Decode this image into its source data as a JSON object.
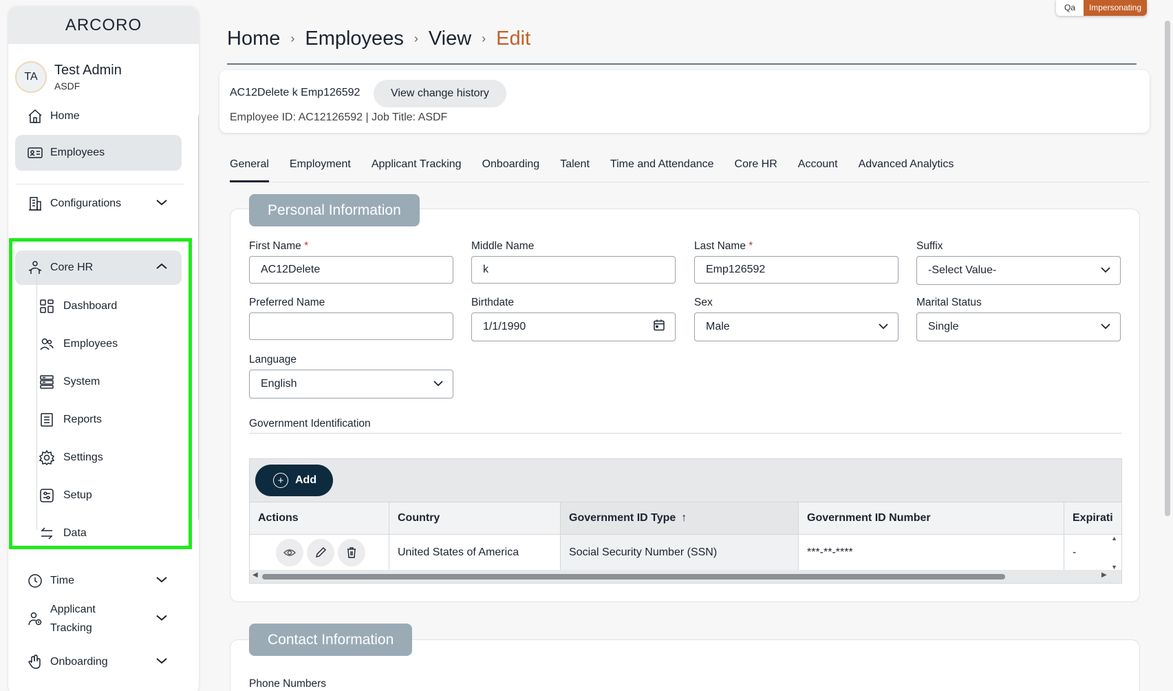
{
  "impersonation": {
    "env": "Qa",
    "label": "Impersonating"
  },
  "sidebar": {
    "logo": "ARCORO",
    "user": {
      "initials": "TA",
      "name": "Test Admin",
      "org": "ASDF"
    },
    "items": [
      {
        "label": "Home",
        "icon": "home-icon"
      },
      {
        "label": "Employees",
        "icon": "id-card-icon"
      },
      {
        "label": "Configurations",
        "icon": "building-icon"
      },
      {
        "label": "Core HR",
        "icon": "people-star-icon"
      }
    ],
    "core_hr_sub": [
      {
        "label": "Dashboard",
        "icon": "dashboard-icon"
      },
      {
        "label": "Employees",
        "icon": "users-icon"
      },
      {
        "label": "System",
        "icon": "server-icon"
      },
      {
        "label": "Reports",
        "icon": "report-icon"
      },
      {
        "label": "Settings",
        "icon": "gear-icon"
      },
      {
        "label": "Setup",
        "icon": "sliders-icon"
      },
      {
        "label": "Data",
        "icon": "transfer-icon"
      }
    ],
    "bottom": [
      {
        "label": "Time",
        "icon": "clock-icon"
      },
      {
        "label": "Applicant Tracking",
        "line1": "Applicant",
        "line2": "Tracking",
        "icon": "applicant-icon"
      },
      {
        "label": "Onboarding",
        "icon": "wave-hand-icon"
      }
    ]
  },
  "breadcrumb": [
    "Home",
    "Employees",
    "View",
    "Edit"
  ],
  "employee": {
    "name": "AC12Delete k Emp126592",
    "view_history": "View change history",
    "meta": "Employee ID: AC12126592 | Job Title: ASDF"
  },
  "tabs": [
    "General",
    "Employment",
    "Applicant Tracking",
    "Onboarding",
    "Talent",
    "Time and Attendance",
    "Core HR",
    "Account",
    "Advanced Analytics"
  ],
  "personal": {
    "title": "Personal Information",
    "first_name": {
      "label": "First Name",
      "value": "AC12Delete"
    },
    "middle_name": {
      "label": "Middle Name",
      "value": "k"
    },
    "last_name": {
      "label": "Last Name",
      "value": "Emp126592"
    },
    "suffix": {
      "label": "Suffix",
      "value": "-Select Value-"
    },
    "preferred_name": {
      "label": "Preferred Name",
      "value": ""
    },
    "birthdate": {
      "label": "Birthdate",
      "value": "1/1/1990"
    },
    "sex": {
      "label": "Sex",
      "value": "Male"
    },
    "marital": {
      "label": "Marital Status",
      "value": "Single"
    },
    "language": {
      "label": "Language",
      "value": "English"
    },
    "required_mark": "*"
  },
  "gov": {
    "title": "Government Identification",
    "add_label": "Add",
    "columns": [
      "Actions",
      "Country",
      "Government ID Type",
      "Government ID Number",
      "Expirati"
    ],
    "sort_indicator": "↑",
    "rows": [
      {
        "country": "United States of America",
        "type": "Social Security Number (SSN)",
        "number": "***-**-****",
        "expiration": "-"
      }
    ]
  },
  "contact": {
    "title": "Contact Information",
    "phone_label": "Phone Numbers"
  }
}
